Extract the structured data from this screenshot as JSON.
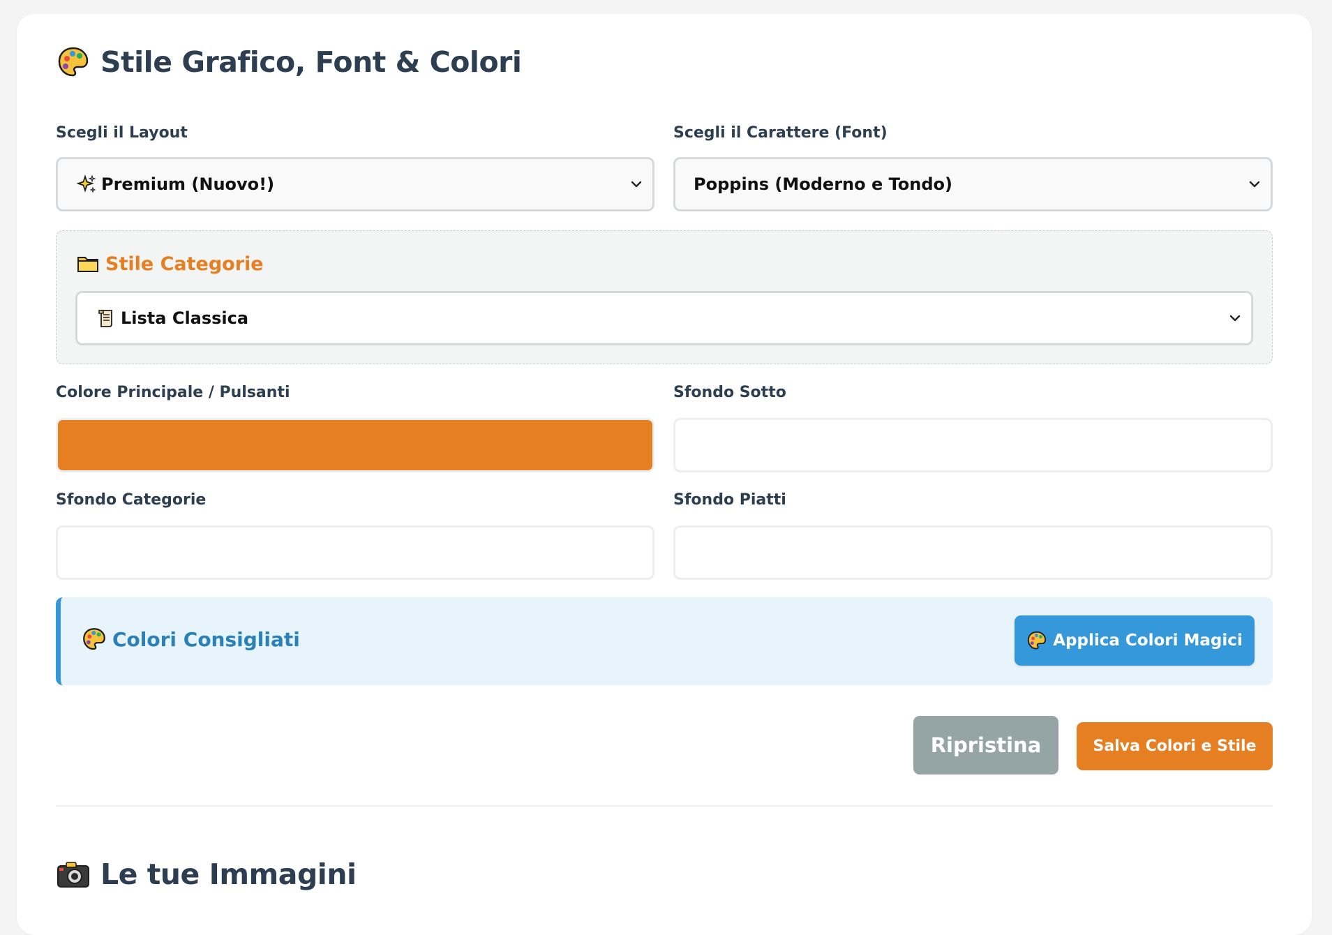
{
  "style_section": {
    "title": "Stile Grafico, Font & Colori",
    "title_icon": "palette-icon"
  },
  "layout_select": {
    "label": "Scegli il Layout",
    "value": "Premium (Nuovo!)",
    "value_icon": "sparkles-icon"
  },
  "font_select": {
    "label": "Scegli il Carattere (Font)",
    "value": "Poppins (Moderno e Tondo)"
  },
  "category_style": {
    "title": "Stile Categorie",
    "title_icon": "folder-icon",
    "select_value": "Lista Classica",
    "select_icon": "scroll-icon"
  },
  "colors": {
    "primary_label": "Colore Principale / Pulsanti",
    "primary_value": "#e67e22",
    "bg_bottom_label": "Sfondo Sotto",
    "bg_bottom_value": "#ffffff",
    "bg_categories_label": "Sfondo Categorie",
    "bg_categories_value": "#ffffff",
    "bg_dishes_label": "Sfondo Piatti",
    "bg_dishes_value": "#ffffff"
  },
  "suggested": {
    "title": "Colori Consigliati",
    "title_icon": "palette-icon",
    "apply_button": "Applica Colori Magici",
    "apply_icon": "palette-icon"
  },
  "actions": {
    "reset_label": "Ripristina",
    "save_label": "Salva Colori e Stile"
  },
  "images_section": {
    "title": "Le tue Immagini",
    "title_icon": "camera-icon"
  },
  "theme": {
    "accent": "#e67e22",
    "info": "#3498db",
    "muted": "#95a5a6",
    "text": "#2c3e50"
  }
}
